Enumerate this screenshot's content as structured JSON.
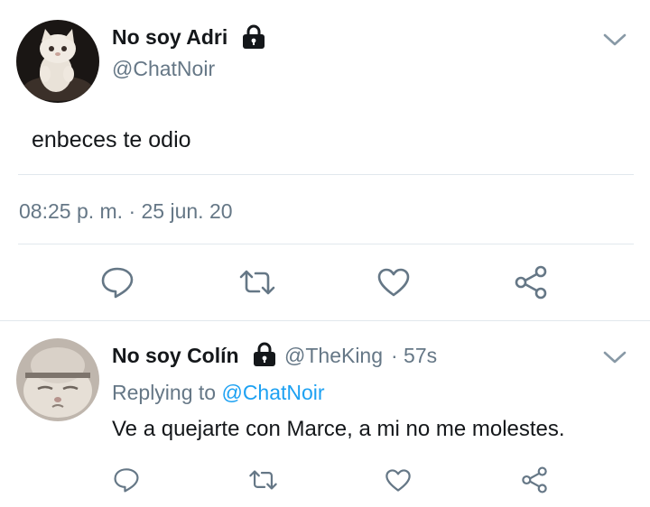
{
  "main_tweet": {
    "display_name": "No soy Adri",
    "handle": "@ChatNoir",
    "text": "enbeces te odio",
    "timestamp": "08:25 p. m. · 25 jun. 20",
    "avatar_icon": "white-cat-avatar",
    "protected_icon": "lock-icon"
  },
  "reply_tweet": {
    "display_name": "No soy Colín",
    "handle": "@TheKing",
    "age": "· 57s",
    "replying_prefix": "Replying to",
    "replying_handle": "@ChatNoir",
    "text": "Ve a quejarte con Marce, a mi no me molestes.",
    "avatar_icon": "grumpy-cat-avatar",
    "protected_icon": "lock-icon"
  },
  "actions": [
    "reply-icon",
    "retweet-icon",
    "like-icon",
    "share-icon"
  ],
  "colors": {
    "text": "#14171a",
    "secondary": "#657786",
    "link": "#1da1f2",
    "divider": "#e1e8ed"
  }
}
